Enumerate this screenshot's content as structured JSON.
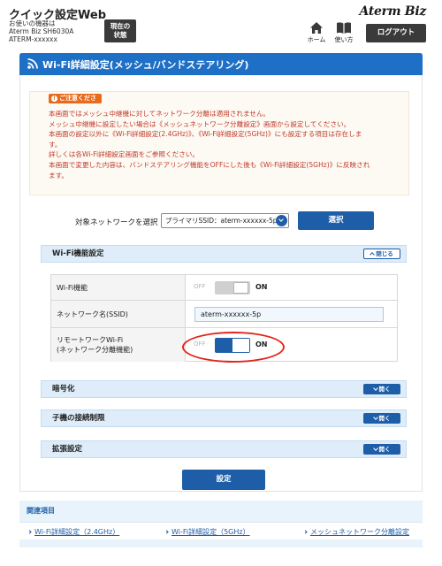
{
  "header": {
    "app_title": "クイック設定Web",
    "device_line1": "お使いの機器は",
    "device_line2": "Aterm Biz SH6030A",
    "device_line3": "ATERM-xxxxxx",
    "status_line1": "現在の",
    "status_line2": "状態",
    "brand": "Aterm Biz",
    "home_label": "ホーム",
    "manual_label": "使い方",
    "logout_label": "ログアウト"
  },
  "page": {
    "title": "Wi-Fi詳細設定(メッシュ/バンドステアリング)"
  },
  "notice": {
    "badge": "ご注意ください",
    "lines": [
      "本画面ではメッシュ中継機に対してネットワーク分離は適用されません。",
      "メッシュ中継機に設定したい場合は《メッシュネットワーク分離設定》画面から設定してください。",
      "本画面の設定以外に《Wi-Fi詳細設定(2.4GHz)》、《Wi-Fi詳細設定(5GHz)》にも設定する項目は存在しま",
      "す。",
      "詳しくは各Wi-Fi詳細設定画面をご参照ください。",
      "本画面で変更した内容は、バンドステアリング機能をOFFにした後も《Wi-Fi詳細設定(5GHz)》に反映され",
      "ます。"
    ]
  },
  "network_select": {
    "label": "対象ネットワークを選択",
    "selected": "プライマリSSID：aterm-xxxxxx-5p",
    "button": "選択"
  },
  "sections": {
    "wifi_function": {
      "title": "Wi-Fi機能設定",
      "toggle_label": "閉じる",
      "rows": {
        "wifi": {
          "label": "Wi-Fi機能",
          "off": "OFF",
          "on": "ON",
          "state": "on"
        },
        "ssid": {
          "label": "ネットワーク名(SSID)",
          "value": "aterm-xxxxxx-5p"
        },
        "remote": {
          "label_line1": "リモートワークWi-Fi",
          "label_line2": "(ネットワーク分離機能)",
          "off": "OFF",
          "on": "ON",
          "state": "on"
        }
      }
    },
    "encryption": {
      "title": "暗号化",
      "toggle_label": "開く"
    },
    "client_limit": {
      "title": "子機の接続制限",
      "toggle_label": "開く"
    },
    "extended": {
      "title": "拡張設定",
      "toggle_label": "開く"
    }
  },
  "apply_button": "設定",
  "related": {
    "title": "関連項目",
    "links": [
      "Wi-Fi詳細設定（2.4GHz）",
      "Wi-Fi詳細設定（5GHz）",
      "メッシュネットワーク分離設定"
    ]
  },
  "colors": {
    "primary_blue": "#1e5ea8",
    "title_blue": "#1e6fc6",
    "notice_red": "#c0392b",
    "badge_orange": "#e96a1b",
    "highlight_red": "#e2261c",
    "section_bg": "#deedf9"
  }
}
